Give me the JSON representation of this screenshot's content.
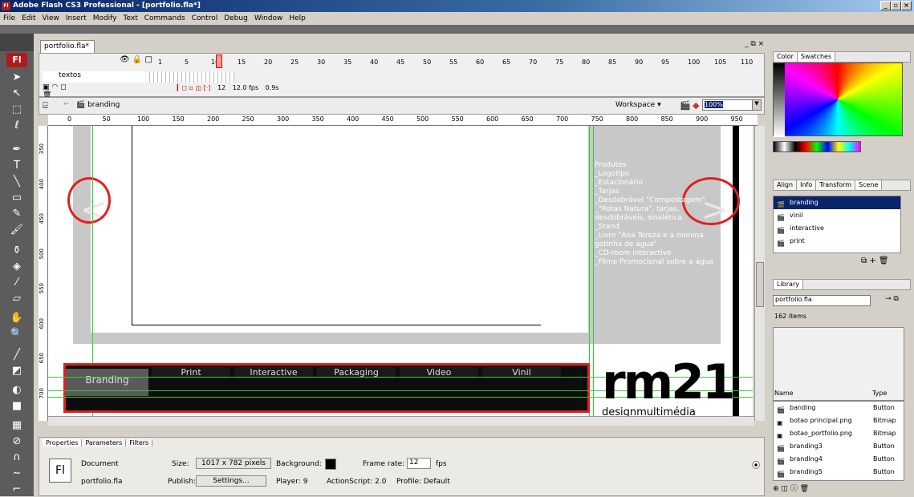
{
  "window": {
    "title": "Adobe Flash CS3 Professional - [portfolio.fla*]",
    "app_icon": "Fl"
  },
  "menu": [
    "File",
    "Edit",
    "View",
    "Insert",
    "Modify",
    "Text",
    "Commands",
    "Control",
    "Debug",
    "Window",
    "Help"
  ],
  "document": {
    "tab": "portfolio.fla*"
  },
  "timeline": {
    "frame_numbers": [
      "1",
      "5",
      "10",
      "15",
      "20",
      "25",
      "30",
      "35",
      "40",
      "45",
      "50",
      "55",
      "60",
      "65",
      "70",
      "75",
      "80",
      "85",
      "90",
      "95",
      "100",
      "105",
      "110"
    ],
    "layer_name": "textos",
    "current_frame": "12",
    "fps": "12.0 fps",
    "time": "0.9s"
  },
  "editbar": {
    "scene": "branding",
    "workspace": "Workspace",
    "zoom": "100%"
  },
  "hruler": [
    "0",
    "50",
    "100",
    "150",
    "200",
    "250",
    "300",
    "350",
    "400",
    "450",
    "500",
    "550",
    "600",
    "650",
    "700",
    "750",
    "800",
    "850",
    "900",
    "950",
    "1000"
  ],
  "vruler": [
    "350",
    "400",
    "450",
    "500",
    "550",
    "600",
    "650",
    "700",
    "750"
  ],
  "stage": {
    "products_title": "Produtos",
    "products": [
      "_Logotipo",
      "_Estacionário",
      "_Tarjas",
      "_Desdobrável \"Compostagem\"",
      "_\"Rotas Natura\", tarjas, desdobráveis, sinalética",
      "_Stand",
      "_Livro \"Ana Tereza e a menina gotinha de água\"",
      "_CD-room interactivo",
      "_Filme Promocional sobre a água"
    ],
    "nav": [
      "Branding",
      "Print",
      "Interactive",
      "Packaging",
      "Video",
      "Vinil"
    ],
    "logo_text": "rm21",
    "logo_sub": "designmultimédia",
    "prev_arrow": "<",
    "next_arrow": ">"
  },
  "color_panel": {
    "tabs": [
      "Color",
      "Swatches"
    ]
  },
  "scene_panel": {
    "tabs": [
      "Align",
      "Info",
      "Transform",
      "Scene"
    ],
    "scenes": [
      "branding",
      "vinil",
      "interactive",
      "print"
    ]
  },
  "library": {
    "tab": "Library",
    "file": "portfolio.fla",
    "count": "162 items",
    "col_name": "Name",
    "col_type": "Type",
    "items": [
      {
        "name": "banding",
        "type": "Button"
      },
      {
        "name": "botao principal.png",
        "type": "Bitmap"
      },
      {
        "name": "botao_portfolio.png",
        "type": "Bitmap"
      },
      {
        "name": "branding3",
        "type": "Button"
      },
      {
        "name": "branding4",
        "type": "Button"
      },
      {
        "name": "branding5",
        "type": "Button"
      }
    ]
  },
  "properties": {
    "tabs": [
      "Properties",
      "Parameters",
      "Filters"
    ],
    "doc_label": "Document",
    "doc_file": "portfolio.fla",
    "size_label": "Size:",
    "size_value": "1017 x 782 pixels",
    "bg_label": "Background:",
    "fr_label": "Frame rate:",
    "fr_value": "12",
    "fps": "fps",
    "publish_label": "Publish:",
    "settings": "Settings...",
    "player": "Player: 9",
    "as": "ActionScript: 2.0",
    "profile": "Profile: Default"
  },
  "colors": {
    "highlight_red": "#e02020",
    "guide_green": "#33cc33",
    "selection": "#0a246a"
  }
}
